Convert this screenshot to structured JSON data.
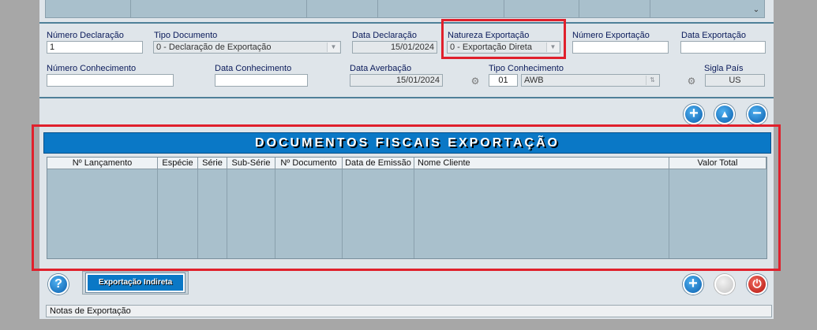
{
  "colors": {
    "banner": "#0a78c6",
    "highlight": "#e0202c",
    "grid": "#a9c0cc"
  },
  "form": {
    "numero_declaracao": {
      "label": "Número Declaração",
      "value": "1"
    },
    "tipo_documento": {
      "label": "Tipo Documento",
      "value": "0 - Declaração de Exportação"
    },
    "data_declaracao": {
      "label": "Data Declaração",
      "value": "15/01/2024"
    },
    "natureza_exportacao": {
      "label": "Natureza Exportação",
      "value": "0 - Exportação Direta"
    },
    "numero_exportacao": {
      "label": "Número Exportação",
      "value": ""
    },
    "data_exportacao": {
      "label": "Data Exportação",
      "value": ""
    },
    "numero_conhecimento": {
      "label": "Número Conhecimento",
      "value": ""
    },
    "data_conhecimento": {
      "label": "Data Conhecimento",
      "value": ""
    },
    "data_averbacao": {
      "label": "Data Averbação",
      "value": "15/01/2024"
    },
    "tipo_conhecimento": {
      "label": "Tipo Conhecimento",
      "code": "01",
      "value": "AWB"
    },
    "sigla_pais": {
      "label": "Sigla País",
      "value": "US"
    }
  },
  "section": {
    "title": "DOCUMENTOS FISCAIS EXPORTAÇÃO"
  },
  "table": {
    "columns": [
      "Nº Lançamento",
      "Espécie",
      "Série",
      "Sub-Série",
      "Nº Documento",
      "Data de Emissão",
      "Nome Cliente",
      "Valor Total"
    ]
  },
  "toolbar": {
    "add_icon": "plus-circle-icon",
    "up_icon": "arrow-up-circle-icon",
    "remove_icon": "minus-circle-icon",
    "help_icon": "question-circle-icon",
    "power_icon": "power-icon",
    "exportacao_indireta": "Exportação Indireta"
  },
  "status": {
    "text": "Notas de Exportação"
  }
}
